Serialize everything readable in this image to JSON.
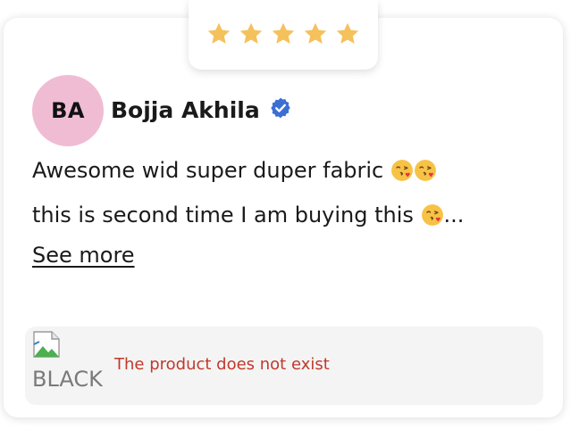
{
  "rating": {
    "value": 5,
    "max": 5,
    "star_color": "#f5c15c"
  },
  "review": {
    "avatar_initials": "BA",
    "avatar_color": "#f0bcd4",
    "reviewer_name": "Bojja Akhila",
    "verified_icon": "verified-badge-icon",
    "verified_color": "#3b6fd4",
    "text_line1": "Awesome wid super duper fabric",
    "text_line2": "this is second time I am buying this",
    "ellipsis": "...",
    "emoji_icon": "face-blowing-kiss-icon",
    "see_more_label": "See more"
  },
  "product": {
    "image_alt": "BLACK",
    "error_message": "The product does not exist",
    "error_color": "#c0392b"
  }
}
